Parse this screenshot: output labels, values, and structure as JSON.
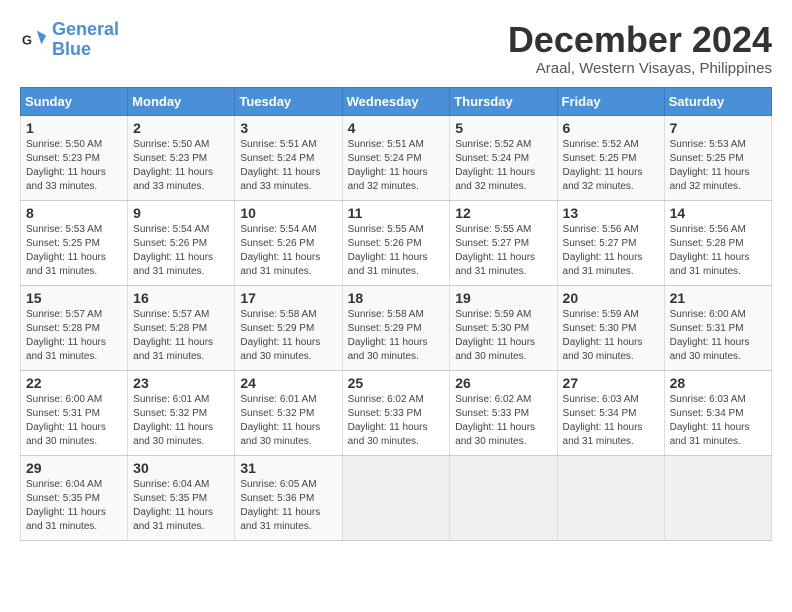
{
  "header": {
    "logo_line1": "General",
    "logo_line2": "Blue",
    "month": "December 2024",
    "location": "Araal, Western Visayas, Philippines"
  },
  "weekdays": [
    "Sunday",
    "Monday",
    "Tuesday",
    "Wednesday",
    "Thursday",
    "Friday",
    "Saturday"
  ],
  "weeks": [
    [
      {
        "day": "1",
        "sunrise": "5:50 AM",
        "sunset": "5:23 PM",
        "daylight": "11 hours and 33 minutes."
      },
      {
        "day": "2",
        "sunrise": "5:50 AM",
        "sunset": "5:23 PM",
        "daylight": "11 hours and 33 minutes."
      },
      {
        "day": "3",
        "sunrise": "5:51 AM",
        "sunset": "5:24 PM",
        "daylight": "11 hours and 33 minutes."
      },
      {
        "day": "4",
        "sunrise": "5:51 AM",
        "sunset": "5:24 PM",
        "daylight": "11 hours and 32 minutes."
      },
      {
        "day": "5",
        "sunrise": "5:52 AM",
        "sunset": "5:24 PM",
        "daylight": "11 hours and 32 minutes."
      },
      {
        "day": "6",
        "sunrise": "5:52 AM",
        "sunset": "5:25 PM",
        "daylight": "11 hours and 32 minutes."
      },
      {
        "day": "7",
        "sunrise": "5:53 AM",
        "sunset": "5:25 PM",
        "daylight": "11 hours and 32 minutes."
      }
    ],
    [
      {
        "day": "8",
        "sunrise": "5:53 AM",
        "sunset": "5:25 PM",
        "daylight": "11 hours and 31 minutes."
      },
      {
        "day": "9",
        "sunrise": "5:54 AM",
        "sunset": "5:26 PM",
        "daylight": "11 hours and 31 minutes."
      },
      {
        "day": "10",
        "sunrise": "5:54 AM",
        "sunset": "5:26 PM",
        "daylight": "11 hours and 31 minutes."
      },
      {
        "day": "11",
        "sunrise": "5:55 AM",
        "sunset": "5:26 PM",
        "daylight": "11 hours and 31 minutes."
      },
      {
        "day": "12",
        "sunrise": "5:55 AM",
        "sunset": "5:27 PM",
        "daylight": "11 hours and 31 minutes."
      },
      {
        "day": "13",
        "sunrise": "5:56 AM",
        "sunset": "5:27 PM",
        "daylight": "11 hours and 31 minutes."
      },
      {
        "day": "14",
        "sunrise": "5:56 AM",
        "sunset": "5:28 PM",
        "daylight": "11 hours and 31 minutes."
      }
    ],
    [
      {
        "day": "15",
        "sunrise": "5:57 AM",
        "sunset": "5:28 PM",
        "daylight": "11 hours and 31 minutes."
      },
      {
        "day": "16",
        "sunrise": "5:57 AM",
        "sunset": "5:28 PM",
        "daylight": "11 hours and 31 minutes."
      },
      {
        "day": "17",
        "sunrise": "5:58 AM",
        "sunset": "5:29 PM",
        "daylight": "11 hours and 30 minutes."
      },
      {
        "day": "18",
        "sunrise": "5:58 AM",
        "sunset": "5:29 PM",
        "daylight": "11 hours and 30 minutes."
      },
      {
        "day": "19",
        "sunrise": "5:59 AM",
        "sunset": "5:30 PM",
        "daylight": "11 hours and 30 minutes."
      },
      {
        "day": "20",
        "sunrise": "5:59 AM",
        "sunset": "5:30 PM",
        "daylight": "11 hours and 30 minutes."
      },
      {
        "day": "21",
        "sunrise": "6:00 AM",
        "sunset": "5:31 PM",
        "daylight": "11 hours and 30 minutes."
      }
    ],
    [
      {
        "day": "22",
        "sunrise": "6:00 AM",
        "sunset": "5:31 PM",
        "daylight": "11 hours and 30 minutes."
      },
      {
        "day": "23",
        "sunrise": "6:01 AM",
        "sunset": "5:32 PM",
        "daylight": "11 hours and 30 minutes."
      },
      {
        "day": "24",
        "sunrise": "6:01 AM",
        "sunset": "5:32 PM",
        "daylight": "11 hours and 30 minutes."
      },
      {
        "day": "25",
        "sunrise": "6:02 AM",
        "sunset": "5:33 PM",
        "daylight": "11 hours and 30 minutes."
      },
      {
        "day": "26",
        "sunrise": "6:02 AM",
        "sunset": "5:33 PM",
        "daylight": "11 hours and 30 minutes."
      },
      {
        "day": "27",
        "sunrise": "6:03 AM",
        "sunset": "5:34 PM",
        "daylight": "11 hours and 31 minutes."
      },
      {
        "day": "28",
        "sunrise": "6:03 AM",
        "sunset": "5:34 PM",
        "daylight": "11 hours and 31 minutes."
      }
    ],
    [
      {
        "day": "29",
        "sunrise": "6:04 AM",
        "sunset": "5:35 PM",
        "daylight": "11 hours and 31 minutes."
      },
      {
        "day": "30",
        "sunrise": "6:04 AM",
        "sunset": "5:35 PM",
        "daylight": "11 hours and 31 minutes."
      },
      {
        "day": "31",
        "sunrise": "6:05 AM",
        "sunset": "5:36 PM",
        "daylight": "11 hours and 31 minutes."
      },
      null,
      null,
      null,
      null
    ]
  ]
}
